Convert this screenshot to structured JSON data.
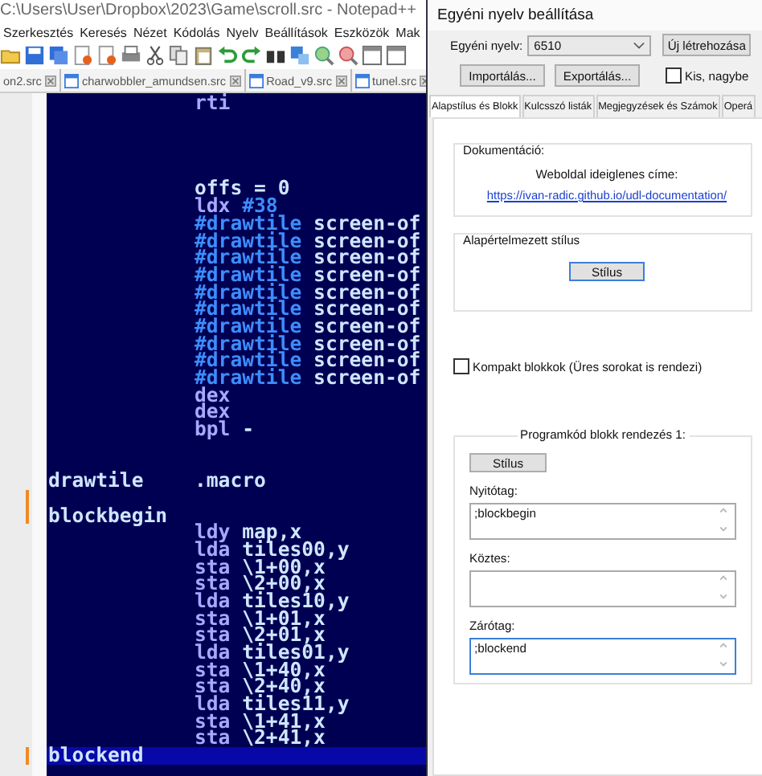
{
  "editor_window": {
    "title": "C:\\Users\\User\\Dropbox\\2023\\Game\\scroll.src - Notepad++",
    "menu": [
      "Szerkesztés",
      "Keresés",
      "Nézet",
      "Kódolás",
      "Nyelv",
      "Beállítások",
      "Eszközök",
      "Mak"
    ],
    "tabs": [
      {
        "label": "on2.src",
        "selected": false
      },
      {
        "label": "charwobbler_amundsen.src",
        "selected": false
      },
      {
        "label": "Road_v9.src",
        "selected": false
      },
      {
        "label": "tunel.src",
        "selected": false
      }
    ],
    "lines": [
      {
        "modified": false,
        "current": false,
        "code": [
          {
            "text": "rti",
            "kind": "op"
          }
        ]
      },
      {
        "modified": false,
        "current": false
      },
      {
        "modified": false,
        "current": false
      },
      {
        "modified": false,
        "current": false
      },
      {
        "modified": false,
        "current": false
      },
      {
        "modified": false,
        "current": false,
        "code": [
          {
            "text": "offs = 0",
            "kind": "arg"
          }
        ]
      },
      {
        "modified": false,
        "current": false,
        "code": [
          {
            "text": "ldx",
            "kind": "op"
          },
          {
            "text": "#38",
            "kind": "macro"
          }
        ]
      },
      {
        "modified": false,
        "current": false,
        "code": [
          {
            "text": "#drawtile",
            "kind": "macro"
          },
          {
            "text": "screen-of",
            "kind": "arg"
          }
        ]
      },
      {
        "modified": false,
        "current": false,
        "code": [
          {
            "text": "#drawtile",
            "kind": "macro"
          },
          {
            "text": "screen-of",
            "kind": "arg"
          }
        ]
      },
      {
        "modified": false,
        "current": false,
        "code": [
          {
            "text": "#drawtile",
            "kind": "macro"
          },
          {
            "text": "screen-of",
            "kind": "arg"
          }
        ]
      },
      {
        "modified": false,
        "current": false,
        "code": [
          {
            "text": "#drawtile",
            "kind": "macro"
          },
          {
            "text": "screen-of",
            "kind": "arg"
          }
        ]
      },
      {
        "modified": false,
        "current": false,
        "code": [
          {
            "text": "#drawtile",
            "kind": "macro"
          },
          {
            "text": "screen-of",
            "kind": "arg"
          }
        ]
      },
      {
        "modified": false,
        "current": false,
        "code": [
          {
            "text": "#drawtile",
            "kind": "macro"
          },
          {
            "text": "screen-of",
            "kind": "arg"
          }
        ]
      },
      {
        "modified": false,
        "current": false,
        "code": [
          {
            "text": "#drawtile",
            "kind": "macro"
          },
          {
            "text": "screen-of",
            "kind": "arg"
          }
        ]
      },
      {
        "modified": false,
        "current": false,
        "code": [
          {
            "text": "#drawtile",
            "kind": "macro"
          },
          {
            "text": "screen-of",
            "kind": "arg"
          }
        ]
      },
      {
        "modified": false,
        "current": false,
        "code": [
          {
            "text": "#drawtile",
            "kind": "macro"
          },
          {
            "text": "screen-of",
            "kind": "arg"
          }
        ]
      },
      {
        "modified": false,
        "current": false,
        "code": [
          {
            "text": "#drawtile",
            "kind": "macro"
          },
          {
            "text": "screen-of",
            "kind": "arg"
          }
        ]
      },
      {
        "modified": false,
        "current": false,
        "code": [
          {
            "text": "dex",
            "kind": "op"
          }
        ]
      },
      {
        "modified": false,
        "current": false,
        "code": [
          {
            "text": "dex",
            "kind": "op"
          }
        ]
      },
      {
        "modified": false,
        "current": false,
        "code": [
          {
            "text": "bpl",
            "kind": "op"
          },
          {
            "text": "-",
            "kind": "arg"
          }
        ]
      },
      {
        "modified": false,
        "current": false
      },
      {
        "modified": false,
        "current": false
      },
      {
        "modified": false,
        "current": false,
        "label": "drawtile",
        "code": [
          {
            "text": ".macro",
            "kind": "arg"
          }
        ]
      },
      {
        "modified": true,
        "current": false
      },
      {
        "modified": true,
        "current": false,
        "label": "blockbegin"
      },
      {
        "modified": false,
        "current": false,
        "code": [
          {
            "text": "ldy",
            "kind": "op"
          },
          {
            "text": "map,x",
            "kind": "arg"
          }
        ]
      },
      {
        "modified": false,
        "current": false,
        "code": [
          {
            "text": "lda",
            "kind": "op"
          },
          {
            "text": "tiles00,y",
            "kind": "arg"
          }
        ]
      },
      {
        "modified": false,
        "current": false,
        "code": [
          {
            "text": "sta",
            "kind": "op"
          },
          {
            "text": "\\1+00,x",
            "kind": "arg"
          }
        ]
      },
      {
        "modified": false,
        "current": false,
        "code": [
          {
            "text": "sta",
            "kind": "op"
          },
          {
            "text": "\\2+00,x",
            "kind": "arg"
          }
        ]
      },
      {
        "modified": false,
        "current": false,
        "code": [
          {
            "text": "lda",
            "kind": "op"
          },
          {
            "text": "tiles10,y",
            "kind": "arg"
          }
        ]
      },
      {
        "modified": false,
        "current": false,
        "code": [
          {
            "text": "sta",
            "kind": "op"
          },
          {
            "text": "\\1+01,x",
            "kind": "arg"
          }
        ]
      },
      {
        "modified": false,
        "current": false,
        "code": [
          {
            "text": "sta",
            "kind": "op"
          },
          {
            "text": "\\2+01,x",
            "kind": "arg"
          }
        ]
      },
      {
        "modified": false,
        "current": false,
        "code": [
          {
            "text": "lda",
            "kind": "op"
          },
          {
            "text": "tiles01,y",
            "kind": "arg"
          }
        ]
      },
      {
        "modified": false,
        "current": false,
        "code": [
          {
            "text": "sta",
            "kind": "op"
          },
          {
            "text": "\\1+40,x",
            "kind": "arg"
          }
        ]
      },
      {
        "modified": false,
        "current": false,
        "code": [
          {
            "text": "sta",
            "kind": "op"
          },
          {
            "text": "\\2+40,x",
            "kind": "arg"
          }
        ]
      },
      {
        "modified": false,
        "current": false,
        "code": [
          {
            "text": "lda",
            "kind": "op"
          },
          {
            "text": "tiles11,y",
            "kind": "arg"
          }
        ]
      },
      {
        "modified": false,
        "current": false,
        "code": [
          {
            "text": "sta",
            "kind": "op"
          },
          {
            "text": "\\1+41,x",
            "kind": "arg"
          }
        ]
      },
      {
        "modified": false,
        "current": false,
        "code": [
          {
            "text": "sta",
            "kind": "op"
          },
          {
            "text": "\\2+41,x",
            "kind": "arg"
          }
        ]
      },
      {
        "modified": true,
        "current": true,
        "label": "blockend"
      }
    ]
  },
  "dialog": {
    "title": "Egyéni nyelv beállítása",
    "language_label": "Egyéni nyelv:",
    "language_value": "6510",
    "new_button": "Új létrehozása",
    "import_button": "Importálás...",
    "export_button": "Exportálás...",
    "case_checkbox": {
      "label": "Kis, nagybe",
      "checked": false
    },
    "tabs": [
      {
        "label": "Alapstílus és Blokk",
        "selected": true
      },
      {
        "label": "Kulcsszó listák",
        "selected": false
      },
      {
        "label": "Megjegyzések és Számok",
        "selected": false
      },
      {
        "label": "Operá",
        "selected": false
      }
    ],
    "documentation": {
      "title": "Dokumentáció:",
      "text": "Weboldal ideiglenes címe:",
      "link": "https://ivan-radic.github.io/udl-documentation/"
    },
    "default_style": {
      "title": "Alapértelmezett stílus",
      "button": "Stílus"
    },
    "compact_checkbox": {
      "label": "Kompakt blokkok (Üres sorokat is rendezi)",
      "checked": false
    },
    "folding": {
      "title": "Programkód blokk rendezés 1:",
      "button": "Stílus",
      "fields": [
        {
          "label": "Nyitótag:",
          "value": ";blockbegin",
          "focused": false
        },
        {
          "label": "Köztes:",
          "focused": false
        },
        {
          "label": "Zárótag:",
          "value": ";blockend",
          "focused": true
        }
      ]
    }
  }
}
